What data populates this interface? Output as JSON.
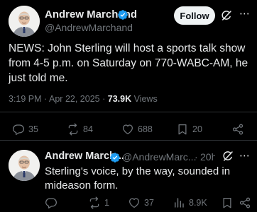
{
  "tweet": {
    "author": {
      "name": "Andrew Marchand",
      "handle": "@AndrewMarchand",
      "avatar": "avatar-photo",
      "verified": true
    },
    "follow_label": "Follow",
    "text": "NEWS: John Sterling will host a sports talk show from 4-5 p.m. on Saturday on 770-WABC-AM, he just told me.",
    "meta": {
      "time": "3:19 PM",
      "date": "Apr 22, 2025",
      "separator": "·",
      "views": "73.9K",
      "views_label": "Views"
    },
    "stats": {
      "replies": "35",
      "reposts": "84",
      "likes": "688",
      "bookmarks": "20"
    }
  },
  "reply": {
    "author": {
      "name": "Andrew March...",
      "handle": "@AndrewMarc...",
      "avatar": "avatar-photo",
      "verified": true
    },
    "separator": "·",
    "time": "20h",
    "text": "Sterling's voice, by the way, sounded in mideason form.",
    "stats": {
      "reposts": "1",
      "likes": "37",
      "views": "8.9K"
    }
  },
  "icons": {
    "more": "⋯",
    "verified": "verified-badge-icon",
    "grok": "grok-icon",
    "reply": "reply-icon",
    "repost": "repost-icon",
    "like": "heart-icon",
    "bookmark": "bookmark-icon",
    "share": "share-icon",
    "views": "analytics-icon"
  },
  "colors": {
    "background": "#000000",
    "text_primary": "#e7e9ea",
    "text_secondary": "#71767b",
    "verified_blue": "#1d9bf0",
    "divider": "#2f3336",
    "follow_button_bg": "#eff3f4"
  }
}
